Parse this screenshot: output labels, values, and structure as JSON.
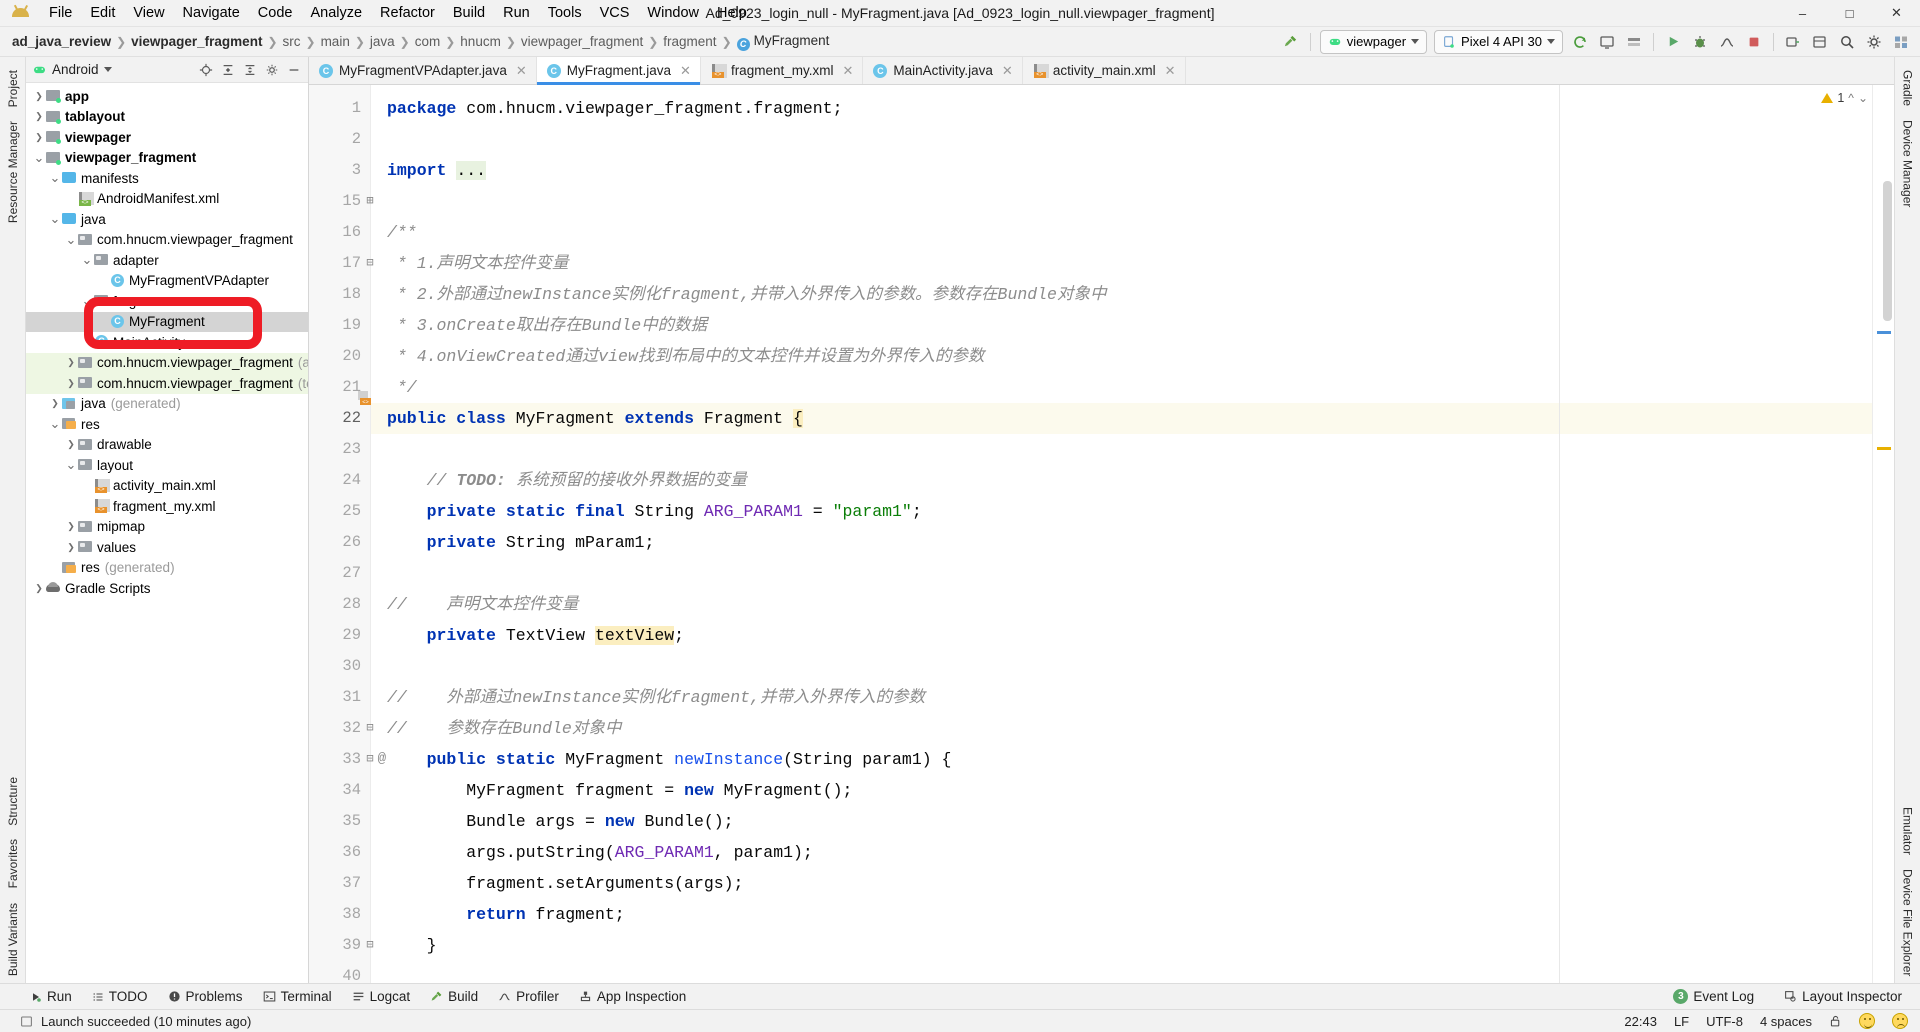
{
  "window": {
    "title": "Ad_0923_login_null - MyFragment.java [Ad_0923_login_null.viewpager_fragment]",
    "minimize": "–",
    "maximize": "□",
    "close": "✕"
  },
  "menu": [
    {
      "label": "File"
    },
    {
      "label": "Edit"
    },
    {
      "label": "View"
    },
    {
      "label": "Navigate"
    },
    {
      "label": "Code"
    },
    {
      "label": "Analyze"
    },
    {
      "label": "Refactor"
    },
    {
      "label": "Build"
    },
    {
      "label": "Run"
    },
    {
      "label": "Tools"
    },
    {
      "label": "VCS"
    },
    {
      "label": "Window"
    },
    {
      "label": "Help"
    }
  ],
  "breadcrumbs": [
    {
      "label": "ad_java_review",
      "style": "bold"
    },
    {
      "label": "viewpager_fragment",
      "style": "bold"
    },
    {
      "label": "src",
      "style": "dim"
    },
    {
      "label": "main",
      "style": "dim"
    },
    {
      "label": "java",
      "style": "dim"
    },
    {
      "label": "com",
      "style": "dim"
    },
    {
      "label": "hnucm",
      "style": "dim"
    },
    {
      "label": "viewpager_fragment",
      "style": "dim"
    },
    {
      "label": "fragment",
      "style": "dim"
    },
    {
      "label": "MyFragment",
      "style": "class"
    }
  ],
  "toolbar": {
    "run_config": "viewpager",
    "device": "Pixel 4 API 30",
    "icons": [
      "build-hammer-icon",
      "sync-gradle-icon",
      "avd-manager-icon",
      "sdk-manager-icon",
      "run-icon",
      "debug-icon",
      "profiler-icon",
      "stop-icon",
      "attach-debugger-icon",
      "layout-inspector-icon",
      "search-everywhere-icon",
      "settings-gear-icon",
      "project-structure-icon"
    ]
  },
  "project_panel": {
    "selector_label": "Android",
    "header_icons": [
      "locate-icon",
      "collapse-all-icon",
      "expand-all-icon",
      "settings-gear-icon",
      "hide-icon"
    ],
    "tree": [
      {
        "depth": 0,
        "arrow": "right",
        "icon": "module",
        "label": "app",
        "bold": true
      },
      {
        "depth": 0,
        "arrow": "right",
        "icon": "module",
        "label": "tablayout",
        "bold": true
      },
      {
        "depth": 0,
        "arrow": "right",
        "icon": "module",
        "label": "viewpager",
        "bold": true
      },
      {
        "depth": 0,
        "arrow": "down",
        "icon": "module",
        "label": "viewpager_fragment",
        "bold": true
      },
      {
        "depth": 1,
        "arrow": "down",
        "icon": "folder-blue",
        "label": "manifests"
      },
      {
        "depth": 2,
        "arrow": "none",
        "icon": "xml-green",
        "label": "AndroidManifest.xml"
      },
      {
        "depth": 1,
        "arrow": "down",
        "icon": "folder-blue",
        "label": "java"
      },
      {
        "depth": 2,
        "arrow": "down",
        "icon": "folder-gray",
        "label": "com.hnucm.viewpager_fragment"
      },
      {
        "depth": 3,
        "arrow": "down",
        "icon": "folder-gray",
        "label": "adapter"
      },
      {
        "depth": 4,
        "arrow": "none",
        "icon": "class",
        "label": "MyFragmentVPAdapter"
      },
      {
        "depth": 3,
        "arrow": "down",
        "icon": "folder-gray",
        "label": "fragment"
      },
      {
        "depth": 4,
        "arrow": "none",
        "icon": "class",
        "label": "MyFragment",
        "selected": true
      },
      {
        "depth": 3,
        "arrow": "none",
        "icon": "class",
        "label": "MainActivity"
      },
      {
        "depth": 2,
        "arrow": "right",
        "icon": "folder-gray",
        "label": "com.hnucm.viewpager_fragment",
        "sub": "(androidTest)",
        "green": true
      },
      {
        "depth": 2,
        "arrow": "right",
        "icon": "folder-gray",
        "label": "com.hnucm.viewpager_fragment",
        "sub": "(test)",
        "green": true
      },
      {
        "depth": 1,
        "arrow": "right",
        "icon": "generated",
        "label": "java",
        "sub": "(generated)"
      },
      {
        "depth": 1,
        "arrow": "down",
        "icon": "res",
        "label": "res"
      },
      {
        "depth": 2,
        "arrow": "right",
        "icon": "folder-gray",
        "label": "drawable"
      },
      {
        "depth": 2,
        "arrow": "down",
        "icon": "folder-gray",
        "label": "layout"
      },
      {
        "depth": 3,
        "arrow": "none",
        "icon": "xml-orange",
        "label": "activity_main.xml"
      },
      {
        "depth": 3,
        "arrow": "none",
        "icon": "xml-orange",
        "label": "fragment_my.xml"
      },
      {
        "depth": 2,
        "arrow": "right",
        "icon": "folder-gray",
        "label": "mipmap"
      },
      {
        "depth": 2,
        "arrow": "right",
        "icon": "folder-gray",
        "label": "values"
      },
      {
        "depth": 1,
        "arrow": "none",
        "icon": "res",
        "label": "res",
        "sub": "(generated)"
      },
      {
        "depth": 0,
        "arrow": "right",
        "icon": "gradle",
        "label": "Gradle Scripts"
      }
    ],
    "highlight": {
      "label": "MyFragment",
      "color": "#ee1c25"
    }
  },
  "left_rail": [
    {
      "label": "Project"
    },
    {
      "label": "Resource Manager"
    },
    {
      "label": "Structure"
    },
    {
      "label": "Favorites"
    },
    {
      "label": "Build Variants"
    }
  ],
  "right_rail_top": [
    {
      "label": "Gradle"
    },
    {
      "label": "Device Manager"
    }
  ],
  "right_rail_bottom": [
    {
      "label": "Emulator"
    },
    {
      "label": "Device File Explorer"
    }
  ],
  "editor_tabs": [
    {
      "label": "MyFragmentVPAdapter.java",
      "icon": "class",
      "active": false
    },
    {
      "label": "MyFragment.java",
      "icon": "class",
      "active": true
    },
    {
      "label": "fragment_my.xml",
      "icon": "xml-orange",
      "active": false
    },
    {
      "label": "MainActivity.java",
      "icon": "class",
      "active": false
    },
    {
      "label": "activity_main.xml",
      "icon": "xml-orange",
      "active": false
    }
  ],
  "editor": {
    "warning_count": "1",
    "lines": [
      {
        "num": "1",
        "fold": "",
        "html": "<span class=\"kw\">package</span> com.hnucm.viewpager_fragment.fragment;"
      },
      {
        "num": "2",
        "fold": "",
        "html": ""
      },
      {
        "num": "3",
        "fold": "+",
        "html": "<span class=\"kw\">import</span> <span class=\"hlbg\">...</span>"
      },
      {
        "num": "15",
        "fold": "",
        "html": ""
      },
      {
        "num": "16",
        "fold": "-",
        "html": "<span class=\"cm\">/**</span>"
      },
      {
        "num": "17",
        "fold": "",
        "html": " <span class=\"cm\">* 1.声明文本控件变量</span>"
      },
      {
        "num": "18",
        "fold": "",
        "html": " <span class=\"cm\">* 2.外部通过newInstance实例化fragment,并带入外界传入的参数。参数存在Bundle对象中</span>"
      },
      {
        "num": "19",
        "fold": "",
        "html": " <span class=\"cm\">* 3.onCreate取出存在Bundle中的数据</span>"
      },
      {
        "num": "20",
        "fold": "",
        "html": " <span class=\"cm\">* 4.onViewCreated通过view找到布局中的文本控件并设置为外界传入的参数</span>"
      },
      {
        "num": "21",
        "fold": "",
        "html": " <span class=\"cm\">*/</span>"
      },
      {
        "num": "22",
        "fold": "",
        "html": "<span class=\"kw\">public class</span> MyFragment <span class=\"kw\">extends</span> Fragment <span class=\"ylbg\">{</span>",
        "hl": true
      },
      {
        "num": "23",
        "fold": "",
        "html": ""
      },
      {
        "num": "24",
        "fold": "",
        "html": "    <span class=\"cm\">// </span><span class=\"cmb\">TODO: </span><span class=\"cm\">系统预留的接收外界数据的变量</span>"
      },
      {
        "num": "25",
        "fold": "",
        "html": "    <span class=\"kw\">private static final</span> String <span class=\"fld\">ARG_PARAM1</span> = <span class=\"str\">\"param1\"</span>;"
      },
      {
        "num": "26",
        "fold": "",
        "html": "    <span class=\"kw\">private</span> String mParam1;"
      },
      {
        "num": "27",
        "fold": "",
        "html": ""
      },
      {
        "num": "28",
        "fold": "",
        "html": "<span class=\"cm\">//    声明文本控件变量</span>"
      },
      {
        "num": "29",
        "fold": "",
        "html": "    <span class=\"kw\">private</span> TextView <span class=\"ylbg\">textView</span>;"
      },
      {
        "num": "30",
        "fold": "",
        "html": ""
      },
      {
        "num": "31",
        "fold": "-",
        "html": "<span class=\"cm\">//    外部通过newInstance实例化fragment,并带入外界传入的参数</span>"
      },
      {
        "num": "32",
        "fold": "-",
        "html": "<span class=\"cm\">//    参数存在Bundle对象中</span>"
      },
      {
        "num": "33",
        "fold": "",
        "html": "    <span class=\"kw\">public static</span> MyFragment <span class=\"mth\">newInstance</span>(String param1) {",
        "at": "@"
      },
      {
        "num": "34",
        "fold": "",
        "html": "        MyFragment fragment = <span class=\"kw\">new</span> MyFragment();"
      },
      {
        "num": "35",
        "fold": "",
        "html": "        Bundle args = <span class=\"kw\">new</span> Bundle();"
      },
      {
        "num": "36",
        "fold": "",
        "html": "        args.putString(<span class=\"fld\">ARG_PARAM1</span>, param1);"
      },
      {
        "num": "37",
        "fold": "",
        "html": "        fragment.setArguments(args);"
      },
      {
        "num": "38",
        "fold": "-",
        "html": "        <span class=\"kw\">return</span> fragment;"
      },
      {
        "num": "39",
        "fold": "",
        "html": "    }"
      },
      {
        "num": "40",
        "fold": "",
        "html": ""
      }
    ]
  },
  "bottom_bar": {
    "items": [
      {
        "label": "Run",
        "icon": "run-icon"
      },
      {
        "label": "TODO",
        "icon": "todo-icon"
      },
      {
        "label": "Problems",
        "icon": "problems-icon"
      },
      {
        "label": "Terminal",
        "icon": "terminal-icon"
      },
      {
        "label": "Logcat",
        "icon": "logcat-icon"
      },
      {
        "label": "Build",
        "icon": "build-hammer-icon"
      },
      {
        "label": "Profiler",
        "icon": "profiler-icon"
      },
      {
        "label": "App Inspection",
        "icon": "app-inspection-icon"
      }
    ],
    "right": [
      {
        "label": "Event Log",
        "badge": "3",
        "icon": "event-log-icon"
      },
      {
        "label": "Layout Inspector",
        "icon": "layout-inspector-icon"
      }
    ]
  },
  "status_bar": {
    "message": "Launch succeeded (10 minutes ago)",
    "time": "22:43",
    "line_sep": "LF",
    "encoding": "UTF-8",
    "indent": "4 spaces",
    "lock_icon": "unlocked-icon",
    "happy_icon": "happy-face-icon",
    "sad_icon": "sad-face-icon"
  }
}
